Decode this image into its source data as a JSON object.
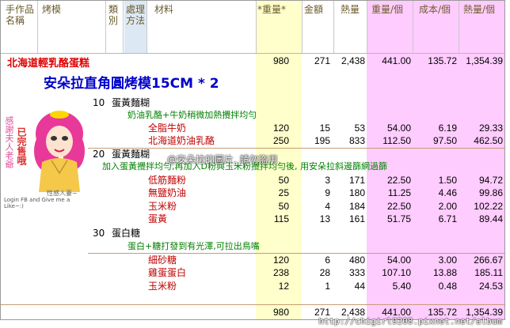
{
  "header": {
    "c1": "手作品名稱",
    "c2": "烤模",
    "c3": "類別",
    "c4": "處理方法",
    "c5": "材料",
    "c6": "*重量*",
    "c7": "金額",
    "c8": "熱量",
    "c9": "重量/個",
    "c10": "成本/個",
    "c11": "熱量/個"
  },
  "product": {
    "name": "北海道輕乳酪蛋糕",
    "weight": "980",
    "amount": "271",
    "calories": "2,438",
    "w_each": "441.00",
    "c_each": "135.72",
    "k_each": "1,354.39",
    "mold": "安朵拉直角圓烤模15CM * 2"
  },
  "steps": [
    {
      "no": "10",
      "name": "蛋黃麵糊",
      "note": "奶油乳酪+牛奶稍微加熱攪拌均勻",
      "items": [
        {
          "name": "全脂牛奶",
          "w": "120",
          "a": "15",
          "k": "53",
          "w1": "54.00",
          "c1": "6.19",
          "k1": "29.33"
        },
        {
          "name": "北海道奶油乳酪",
          "w": "250",
          "a": "195",
          "k": "833",
          "w1": "112.50",
          "c1": "97.50",
          "k1": "462.50"
        }
      ]
    },
    {
      "no": "20",
      "name": "蛋黃麵糊",
      "note": "加入蛋黃攪拌均勻,再加入D粉與玉米粉攪拌均勻後, 用安朵拉斜邊篩網過篩",
      "items": [
        {
          "name": "低筋麵粉",
          "w": "50",
          "a": "3",
          "k": "171",
          "w1": "22.50",
          "c1": "1.50",
          "k1": "94.72"
        },
        {
          "name": "無鹽奶油",
          "w": "25",
          "a": "9",
          "k": "180",
          "w1": "11.25",
          "c1": "4.46",
          "k1": "99.86"
        },
        {
          "name": "玉米粉",
          "w": "50",
          "a": "4",
          "k": "184",
          "w1": "22.50",
          "c1": "2.00",
          "k1": "102.22"
        },
        {
          "name": "蛋黃",
          "w": "115",
          "a": "13",
          "k": "161",
          "w1": "51.75",
          "c1": "6.71",
          "k1": "89.44"
        }
      ]
    },
    {
      "no": "30",
      "name": "蛋白糖",
      "note": "蛋白+糖打發到有光澤,可拉出鳥嘴",
      "items": [
        {
          "name": "細砂糖",
          "w": "120",
          "a": "6",
          "k": "480",
          "w1": "54.00",
          "c1": "3.00",
          "k1": "266.67"
        },
        {
          "name": "雞蛋蛋白",
          "w": "238",
          "a": "28",
          "k": "333",
          "w1": "107.10",
          "c1": "13.88",
          "k1": "185.11"
        },
        {
          "name": "玉米粉",
          "w": "12",
          "a": "1",
          "k": "44",
          "w1": "5.40",
          "c1": "0.48",
          "k1": "24.53"
        }
      ]
    }
  ],
  "totals": {
    "weight": "980",
    "amount": "271",
    "calories": "2,438",
    "w_each": "441.00",
    "c_each": "135.72",
    "k_each": "1,354.39"
  },
  "badge": {
    "left": "感謝夫人老爺",
    "right": "已完售哦",
    "caption": "Login FB and Give me a Like~:)",
    "brand": "性感人妻~"
  },
  "watermark": "@安朵拉的圖片, 請勿盜用",
  "url": "http://chigirl9208.pixnet.net/album",
  "colors": {
    "yellow_col": "#ffffcc",
    "pink_col": "#ffccff",
    "header_blue": "#dde8f5"
  }
}
